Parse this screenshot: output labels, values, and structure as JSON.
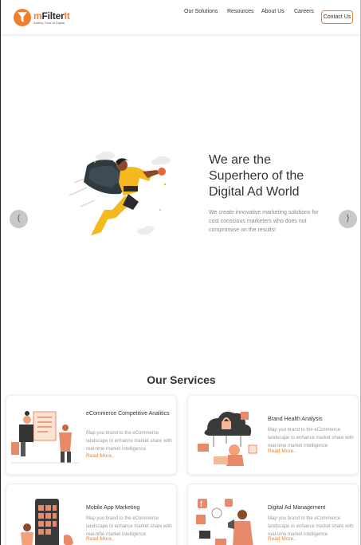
{
  "brand": {
    "name_first": "m",
    "name_rest": "Filter",
    "name_suffix": "It",
    "tagline": "Adding Trust to Digital",
    "accent": "#ef7f2d"
  },
  "nav": {
    "items": [
      "Our Solutions",
      "Resources",
      "About Us",
      "Careers"
    ],
    "contact_label": "Contact Us"
  },
  "hero": {
    "title_lines": [
      "We are the",
      "Superhero of the",
      "Digital Ad World"
    ],
    "description": "We create innovative marketing solutions for cost conscious marketers who does not compromise on the results!",
    "prev_icon": "chevron-left-icon",
    "next_icon": "chevron-right-icon",
    "prev_glyph": "⟨",
    "next_glyph": "⟩"
  },
  "services": {
    "heading": "Our Services",
    "cards": [
      {
        "title": "eCommerce Competitive Analitics",
        "description": "Map you brand to the eCommerce landscape to enhance market share with real-time market intelligence",
        "link": "Read More.."
      },
      {
        "title": "Brand Health Analysis",
        "description": "Map you brand to the eCommerce landscape to enhance market share with real-time market intelligence",
        "link": "Read More.."
      },
      {
        "title": "Mobile App Marketing",
        "description": "Map you brand to the eCommerce landscape to enhance market share with real-time market intelligence",
        "link": "Read More.."
      },
      {
        "title": "Digital Ad Management",
        "description": "Map you brand to the eCommerce landscape to enhance market share with real-time market intelligence",
        "link": "Read More.."
      }
    ]
  }
}
